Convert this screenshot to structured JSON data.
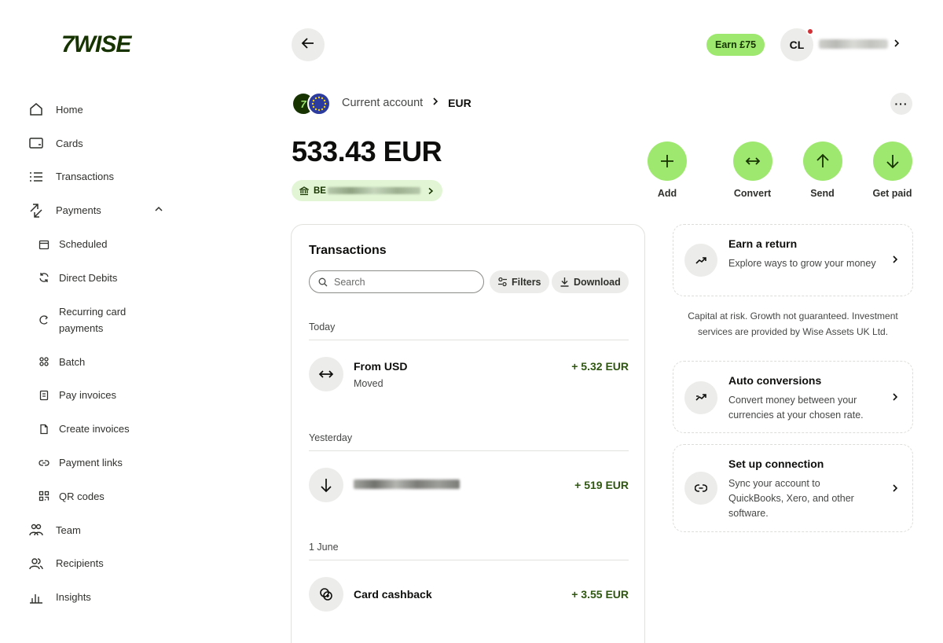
{
  "brand": {
    "logo_text": "7WISE",
    "accent": "#9fe870",
    "dark_green": "#163300"
  },
  "sidebar": {
    "items": [
      {
        "label": "Home",
        "icon": "home-icon"
      },
      {
        "label": "Cards",
        "icon": "card-icon"
      },
      {
        "label": "Transactions",
        "icon": "list-icon"
      },
      {
        "label": "Payments",
        "icon": "payments-icon",
        "expanded": true
      },
      {
        "label": "Scheduled",
        "icon": "calendar-icon"
      },
      {
        "label": "Direct Debits",
        "icon": "refresh-icon"
      },
      {
        "label": "Recurring card payments",
        "label_line1": "Recurring card",
        "label_line2": "payments",
        "icon": "recurring-icon"
      },
      {
        "label": "Batch",
        "icon": "batch-icon"
      },
      {
        "label": "Pay invoices",
        "icon": "invoice-icon"
      },
      {
        "label": "Create invoices",
        "icon": "document-icon"
      },
      {
        "label": "Payment links",
        "icon": "link-icon"
      },
      {
        "label": "QR codes",
        "icon": "qr-icon"
      },
      {
        "label": "Team",
        "icon": "team-icon"
      },
      {
        "label": "Recipients",
        "icon": "recipients-icon"
      },
      {
        "label": "Insights",
        "icon": "insights-icon"
      }
    ]
  },
  "header": {
    "earn_label": "Earn £75",
    "avatar_initials": "CL",
    "notification_color": "#d03238"
  },
  "account": {
    "breadcrumb_parent": "Current account",
    "breadcrumb_current": "EUR",
    "balance": "533.43 EUR",
    "iban_prefix": "BE"
  },
  "actions": [
    {
      "label": "Add",
      "icon": "plus-icon"
    },
    {
      "label": "Convert",
      "icon": "convert-icon"
    },
    {
      "label": "Send",
      "icon": "arrow-up-icon"
    },
    {
      "label": "Get paid",
      "icon": "arrow-down-icon"
    }
  ],
  "transactions": {
    "title": "Transactions",
    "search_placeholder": "Search",
    "filters_label": "Filters",
    "download_label": "Download",
    "groups": [
      {
        "label": "Today",
        "items": [
          {
            "name": "From USD",
            "subtitle": "Moved",
            "amount": "+ 5.32 EUR",
            "icon": "convert-icon"
          }
        ]
      },
      {
        "label": "Yesterday",
        "items": [
          {
            "name": "",
            "amount": "+ 519 EUR",
            "icon": "arrow-down-icon"
          }
        ]
      },
      {
        "label": "1 June",
        "items": [
          {
            "name": "Card cashback",
            "amount": "+ 3.55 EUR",
            "icon": "cashback-icon"
          }
        ]
      }
    ],
    "amount_color": "#2f5711"
  },
  "promos": [
    {
      "title": "Earn a return",
      "description": "Explore ways to grow your money",
      "icon": "trend-up-icon"
    },
    {
      "title": "Auto conversions",
      "description": "Convert money between your currencies at your chosen rate.",
      "icon": "auto-convert-icon"
    },
    {
      "title": "Set up connection",
      "description": "Sync your account to QuickBooks, Xero, and other software.",
      "icon": "connection-icon"
    }
  ],
  "disclaimer": "Capital at risk. Growth not guaranteed. Investment services are provided by Wise Assets UK Ltd."
}
